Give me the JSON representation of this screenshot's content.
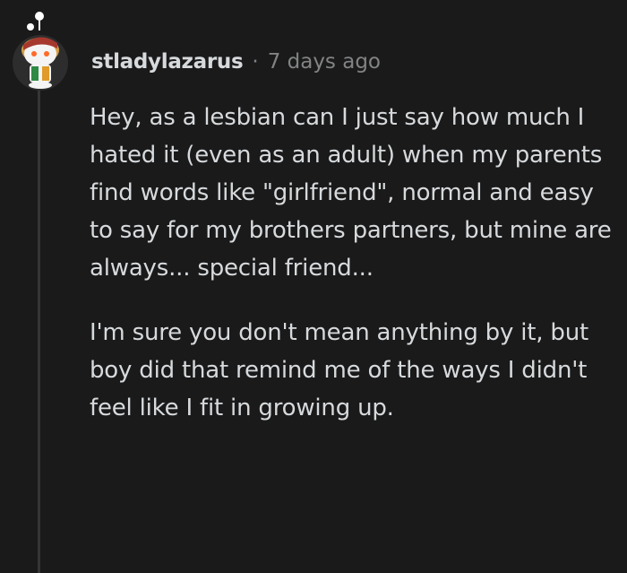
{
  "comment": {
    "username": "stladylazarus",
    "separator": "·",
    "timestamp": "7 days ago",
    "avatar_icon": "snoo-avatar-icon",
    "paragraphs": [
      "Hey, as a lesbian can I just say how much I hated it (even as an adult) when my parents find words like \"girlfriend\", normal and easy to say for my brothers partners, but mine are always... special friend...",
      "I'm sure you don't mean anything by it, but boy did that remind me of the ways I didn't feel like I fit in growing up."
    ]
  },
  "colors": {
    "background": "#1a1a1b",
    "text": "#d7dadc",
    "meta": "#818384",
    "thread_line": "#343536"
  }
}
